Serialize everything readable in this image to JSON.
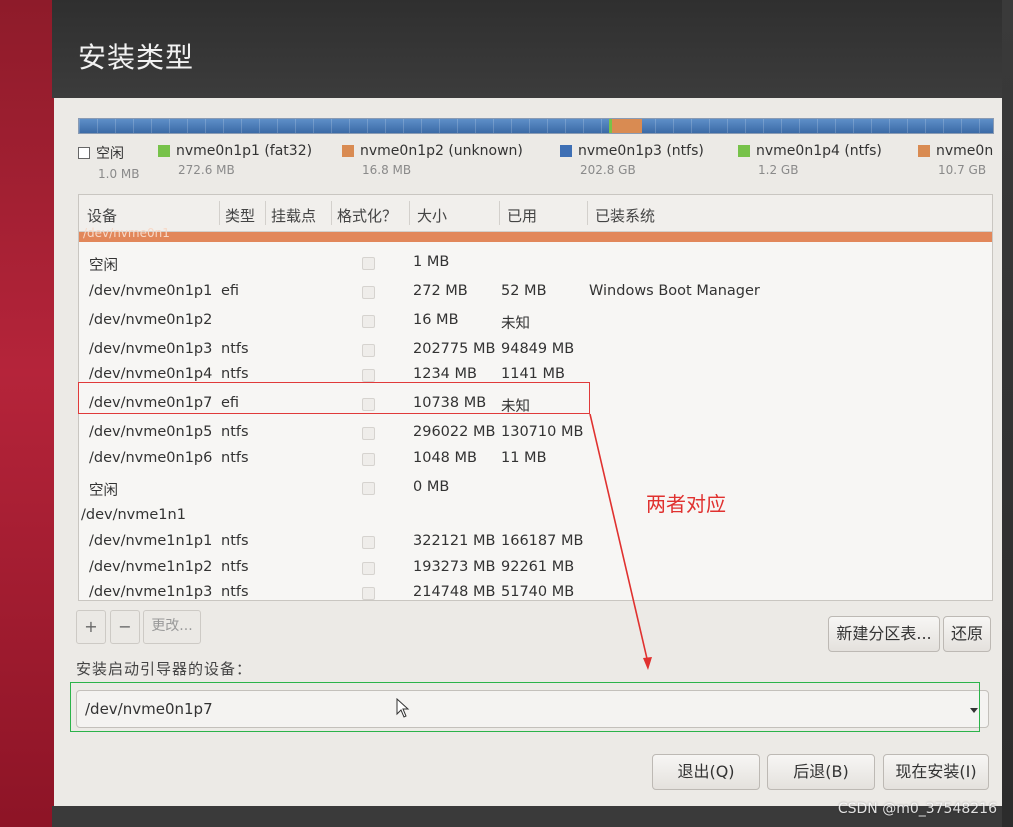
{
  "window": {
    "title": "安装类型"
  },
  "legend": [
    {
      "label": "空闲",
      "size": "1.0 MB",
      "color": "#ffffff"
    },
    {
      "label": "nvme0n1p1 (fat32)",
      "size": "272.6 MB",
      "color": "#77c24a"
    },
    {
      "label": "nvme0n1p2 (unknown)",
      "size": "16.8 MB",
      "color": "#d98b52"
    },
    {
      "label": "nvme0n1p3 (ntfs)",
      "size": "202.8 GB",
      "color": "#3e6fb4"
    },
    {
      "label": "nvme0n1p4 (ntfs)",
      "size": "1.2 GB",
      "color": "#77c24a"
    },
    {
      "label": "nvme0n",
      "size": "10.7 GB",
      "color": "#d98b52"
    }
  ],
  "table": {
    "columns": [
      "设备",
      "类型",
      "挂载点",
      "格式化？",
      "大小",
      "已用",
      "已装系统"
    ],
    "group_label": "/dev/nvme0n1",
    "rows": [
      {
        "device": "空闲",
        "type": "",
        "size": "1 MB",
        "used": "",
        "system": ""
      },
      {
        "device": "/dev/nvme0n1p1",
        "type": "efi",
        "size": "272 MB",
        "used": "52 MB",
        "system": "Windows Boot Manager"
      },
      {
        "device": "/dev/nvme0n1p2",
        "type": "",
        "size": "16 MB",
        "used": "未知",
        "system": ""
      },
      {
        "device": "/dev/nvme0n1p3",
        "type": "ntfs",
        "size": "202775 MB",
        "used": "94849 MB",
        "system": ""
      },
      {
        "device": "/dev/nvme0n1p4",
        "type": "ntfs",
        "size": "1234 MB",
        "used": "1141 MB",
        "system": ""
      },
      {
        "device": "/dev/nvme0n1p7",
        "type": "efi",
        "size": "10738 MB",
        "used": "未知",
        "system": ""
      },
      {
        "device": "/dev/nvme0n1p5",
        "type": "ntfs",
        "size": "296022 MB",
        "used": "130710 MB",
        "system": ""
      },
      {
        "device": "/dev/nvme0n1p6",
        "type": "ntfs",
        "size": "1048 MB",
        "used": "11 MB",
        "system": ""
      },
      {
        "device": "空闲",
        "type": "",
        "size": "0 MB",
        "used": "",
        "system": ""
      },
      {
        "device": "/dev/nvme1n1",
        "type": "",
        "size": "",
        "used": "",
        "system": ""
      },
      {
        "device": "/dev/nvme1n1p1",
        "type": "ntfs",
        "size": "322121 MB",
        "used": "166187 MB",
        "system": ""
      },
      {
        "device": "/dev/nvme1n1p2",
        "type": "ntfs",
        "size": "193273 MB",
        "used": "92261 MB",
        "system": ""
      },
      {
        "device": "/dev/nvme1n1p3",
        "type": "ntfs",
        "size": "214748 MB",
        "used": "51740 MB",
        "system": ""
      }
    ]
  },
  "toolbar": {
    "add": "+",
    "remove": "−",
    "change": "更改..."
  },
  "actions": {
    "new_table": "新建分区表...",
    "revert": "还原"
  },
  "boot": {
    "label": "安装启动引导器的设备：",
    "value": "/dev/nvme0n1p7"
  },
  "annotation": {
    "text": "两者对应",
    "color": "#e0312f"
  },
  "footer": {
    "quit": "退出(Q)",
    "back": "后退(B)",
    "install": "现在安装(I)"
  },
  "watermark": "CSDN @m0_37548216"
}
